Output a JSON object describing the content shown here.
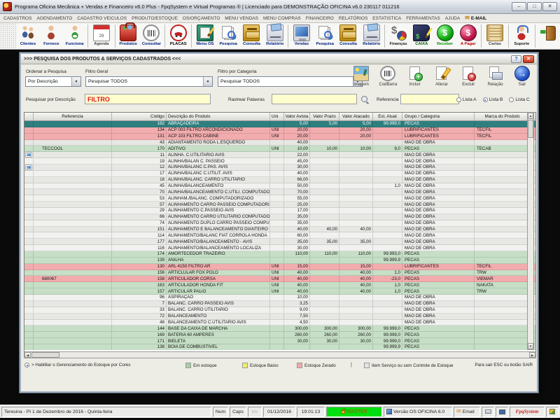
{
  "colors": {
    "selected_row": "#2F7F7F",
    "row_in_stock": "#C6DFC6",
    "row_zero_stock": "#F2ACAE",
    "search_text": "#E01818",
    "master_badge": "#00E010",
    "brand_text": "#CC2020"
  },
  "title_bar": {
    "title": "Programa Oficina Mecânica + Vendas e Financeiro v6.0 Plus - FpqSystem e Virtual Programas ® | Licenciado para  DEMONSTRAÇÃO OFICINA v6.0 230117 011216"
  },
  "menu_bar": {
    "items": [
      {
        "label": "CADASTROS"
      },
      {
        "label": "AGENDAMENTO"
      },
      {
        "label": "CADASTRO VEICULOS"
      },
      {
        "label": "PRODUTO/ESTOQUE"
      },
      {
        "label": "OS/ORÇAMENTO"
      },
      {
        "label": "MENU VENDAS"
      },
      {
        "label": "MENU COMPRAS"
      },
      {
        "label": "FINANCEIRO"
      },
      {
        "label": "RELATÓRIOS"
      },
      {
        "label": "ESTATISTICA"
      },
      {
        "label": "FERRAMENTAS"
      },
      {
        "label": "AJUDA"
      },
      {
        "label": "E-MAIL",
        "icon": "email-icon",
        "bold": true
      }
    ]
  },
  "toolbar": {
    "buttons": [
      {
        "label": "Clientes",
        "icon": "clients-icon",
        "color": "#002080"
      },
      {
        "label": "Fornece",
        "icon": "suppliers-icon",
        "color": "#002080"
      },
      {
        "label": "Funciona",
        "icon": "employees-icon",
        "color": "#002080"
      },
      {
        "label": "Agenda",
        "icon": "calendar-icon",
        "icon_text": "29",
        "color": "#454545",
        "sep_before": true
      },
      {
        "label": "Produtos",
        "icon": "toolbox-icon",
        "color": "#002080",
        "sep_before": true
      },
      {
        "label": "Consultar",
        "icon": "barcode-icon",
        "color": "#002080"
      },
      {
        "label": "PLACAS",
        "icon": "car-plate-icon",
        "color": "#000000",
        "sep_before": true
      },
      {
        "label": "Menu OS",
        "icon": "clipboard-icon",
        "color": "#002080",
        "sep_before": true
      },
      {
        "label": "Pesquisa",
        "icon": "search-docs-icon",
        "color": "#002080"
      },
      {
        "label": "Consulta",
        "icon": "drawer-icon",
        "color": "#002080"
      },
      {
        "label": "Relatório",
        "icon": "printer-icon",
        "color": "#002080"
      },
      {
        "label": "Vendas",
        "icon": "monitor-icon",
        "color": "#002080",
        "sep_before": true
      },
      {
        "label": "Pesquisa",
        "icon": "search-docs-icon",
        "color": "#002080"
      },
      {
        "label": "Consulta",
        "icon": "drawer-icon",
        "color": "#002080"
      },
      {
        "label": "Relatório",
        "icon": "printer-icon",
        "color": "#002080"
      },
      {
        "label": "Finanças",
        "icon": "finance-icon",
        "color": "#202020",
        "sep_before": true
      },
      {
        "label": "CAIXA",
        "icon": "cashbook-icon",
        "color": "#006000"
      },
      {
        "label": "Receber",
        "icon": "receive-icon",
        "color": "#009000"
      },
      {
        "label": "A Pagar",
        "icon": "pay-icon",
        "color": "#C00000"
      },
      {
        "label": "Cartas",
        "icon": "scroll-icon",
        "color": "#454545",
        "sep_before": true
      },
      {
        "label": "Suporte",
        "icon": "support-icon",
        "color": "#202020",
        "sep_before": true
      },
      {
        "label": "",
        "icon": "exit-icon",
        "color": "#202020",
        "sep_before": true
      }
    ]
  },
  "window": {
    "title": ">>>  PESQUISA DOS PRODUTOS & SERVIÇOS CADASTRADOS  <<<",
    "help_button": "?",
    "close_button": "x",
    "filters": {
      "ordenar_label": "Ordenar a Pesquisa",
      "ordenar_value": "Por Descrição",
      "geral_label": "Filtro Geral",
      "geral_value": "Pesquisar TODOS",
      "categoria_label": "Filtro por Categoria",
      "categoria_value": "Pesquisar TODOS"
    },
    "search": {
      "desc_label": "Pesquisar por Descrição",
      "desc_value": "FILTRO",
      "rastrear_label": "Rastrear Palavras",
      "rastrear_value": "",
      "ref_label": "Referencia",
      "ref_value": ""
    },
    "actions": [
      {
        "label": "Imagem",
        "icon": "image-icon"
      },
      {
        "label": "CodBarra",
        "icon": "codbarra-icon"
      },
      {
        "label": "Incluir",
        "icon": "incluir-icon"
      },
      {
        "label": "Alterar",
        "icon": "alterar-icon"
      },
      {
        "label": "Excluir",
        "icon": "excluir-icon"
      },
      {
        "label": "Relação",
        "icon": "relacao-icon"
      },
      {
        "label": "Sair",
        "icon": "sair-icon"
      }
    ],
    "lists": {
      "options": [
        "Lista A",
        "Lista B",
        "Lista C"
      ],
      "selected": "Lista B"
    },
    "table": {
      "columns": [
        "Referencia",
        "Código",
        "Descrição do Produto",
        "Uni",
        "Valor Avista",
        "Valor Prazo",
        "Valor Atacado",
        "Est. Atual",
        "Grupo / Categoria",
        "Marca do Produto"
      ],
      "rows": [
        {
          "ref": "",
          "codigo": "182",
          "desc": "ABRAÇADEIRA",
          "uni": "",
          "avista": "5,00",
          "prazo": "5,00",
          "atacado": "5,00",
          "est": "99.999,0",
          "grupo": "PECAS",
          "marca": "",
          "color": "teal",
          "img": false
        },
        {
          "ref": "",
          "codigo": "134",
          "desc": "ACP 003 FILTRO ARCONDICIONADO",
          "uni": "UNI",
          "avista": "20,00",
          "prazo": "",
          "atacado": "20,00",
          "est": "",
          "grupo": "LUBRIFICANTES",
          "marca": "TECFIL",
          "color": "pink",
          "img": false
        },
        {
          "ref": "",
          "codigo": "131",
          "desc": "ACP 103 FILTRO CABINE",
          "uni": "UNI",
          "avista": "20,00",
          "prazo": "",
          "atacado": "20,00",
          "est": "",
          "grupo": "LUBRIFICANTES",
          "marca": "TECFIL",
          "color": "pink",
          "img": false
        },
        {
          "ref": "",
          "codigo": "43",
          "desc": "ADIANTAMENTO RODA L.ESQUERDO",
          "uni": "",
          "avista": "40,00",
          "prazo": "",
          "atacado": "",
          "est": "",
          "grupo": "MAO DE OBRA",
          "marca": "",
          "color": "",
          "img": false
        },
        {
          "ref": "TECCOOL",
          "codigo": "170",
          "desc": "ADITIVO",
          "uni": "UNI",
          "avista": "10,00",
          "prazo": "10,00",
          "atacado": "10,00",
          "est": "9,0",
          "grupo": "PECAS",
          "marca": "TECAB",
          "color": "green",
          "img": false
        },
        {
          "ref": "",
          "codigo": "11",
          "desc": "ALINHA. C.UTILITARIO AVIS",
          "uni": "",
          "avista": "22,00",
          "prazo": "",
          "atacado": "",
          "est": "",
          "grupo": "MAO DE OBRA",
          "marca": "",
          "color": "",
          "img": true
        },
        {
          "ref": "",
          "codigo": "19",
          "desc": "ALINHA/BALAN C. PASSEIO",
          "uni": "",
          "avista": "45,00",
          "prazo": "",
          "atacado": "",
          "est": "",
          "grupo": "MAO DE OBRA",
          "marca": "",
          "color": "",
          "img": false
        },
        {
          "ref": "",
          "codigo": "12",
          "desc": "ALINHA/BALANC C.PAS. AVIS",
          "uni": "",
          "avista": "30,00",
          "prazo": "",
          "atacado": "",
          "est": "",
          "grupo": "MAO DE OBRA",
          "marca": "",
          "color": "",
          "img": true
        },
        {
          "ref": "",
          "codigo": "17",
          "desc": "ALINHA/BALANC C.UTILIT. AVIS",
          "uni": "",
          "avista": "40,00",
          "prazo": "",
          "atacado": "",
          "est": "",
          "grupo": "MAO DE OBRA",
          "marca": "",
          "color": "",
          "img": false
        },
        {
          "ref": "",
          "codigo": "18",
          "desc": "ALINHA/BALANC. CARRO UTILITARIO",
          "uni": "",
          "avista": "66,00",
          "prazo": "",
          "atacado": "",
          "est": "",
          "grupo": "MAO DE OBRA",
          "marca": "",
          "color": "",
          "img": false
        },
        {
          "ref": "",
          "codigo": "45",
          "desc": "ALINHA/BALANCEAMENTO",
          "uni": "",
          "avista": "50,00",
          "prazo": "",
          "atacado": "",
          "est": "1,0",
          "grupo": "MAO DE OBRA",
          "marca": "",
          "color": "",
          "img": false
        },
        {
          "ref": "",
          "codigo": "70",
          "desc": "ALINHA/BALANCEAMENTO C.UTILI. COMPUTADORIZADO",
          "uni": "",
          "avista": "70,00",
          "prazo": "",
          "atacado": "",
          "est": "",
          "grupo": "MAO DE OBRA",
          "marca": "",
          "color": "",
          "img": false
        },
        {
          "ref": "",
          "codigo": "53",
          "desc": "ALINHAM./BALANC.  COMPUTADORIZADO",
          "uni": "",
          "avista": "55,00",
          "prazo": "",
          "atacado": "",
          "est": "",
          "grupo": "MAO DE OBRA",
          "marca": "",
          "color": "",
          "img": false
        },
        {
          "ref": "",
          "codigo": "57",
          "desc": "ALINHAMENTO  CARRO PASSEIO  COMPUTADORIZADO",
          "uni": "",
          "avista": "25,00",
          "prazo": "",
          "atacado": "",
          "est": "",
          "grupo": "MAO DE OBRA",
          "marca": "",
          "color": "",
          "img": false
        },
        {
          "ref": "",
          "codigo": "29",
          "desc": "ALINHAMENTO C.PASSEIO AVIS",
          "uni": "",
          "avista": "17,00",
          "prazo": "",
          "atacado": "",
          "est": "",
          "grupo": "MAO DE OBRA",
          "marca": "",
          "color": "",
          "img": false
        },
        {
          "ref": "",
          "codigo": "66",
          "desc": "ALINHAMENTO CARRO UTILITARIO COMPUTADORIZADO",
          "uni": "",
          "avista": "35,00",
          "prazo": "",
          "atacado": "",
          "est": "",
          "grupo": "MAO DE OBRA",
          "marca": "",
          "color": "",
          "img": false
        },
        {
          "ref": "",
          "codigo": "74",
          "desc": "ALINHAMENTO DUPLO CARRO PASSEIO COMPUTADORIZADO",
          "uni": "",
          "avista": "35,00",
          "prazo": "",
          "atacado": "",
          "est": "",
          "grupo": "MAO DE OBRA",
          "marca": "",
          "color": "",
          "img": false
        },
        {
          "ref": "",
          "codigo": "151",
          "desc": "ALINHAMENTO E BALANCEAMENTO DIANTEIRO",
          "uni": "",
          "avista": "40,00",
          "prazo": "40,00",
          "atacado": "40,00",
          "est": "",
          "grupo": "MAO DE OBRA",
          "marca": "",
          "color": "",
          "img": false
        },
        {
          "ref": "",
          "codigo": "114",
          "desc": "ALINHAMENTO/BALANC   FIAT CORROLA HONDA",
          "uni": "",
          "avista": "60,00",
          "prazo": "",
          "atacado": "",
          "est": "",
          "grupo": "MAO DE OBRA",
          "marca": "",
          "color": "",
          "img": false
        },
        {
          "ref": "",
          "codigo": "177",
          "desc": "ALINHAMENTO/BALANCEAMENTO - AVIS",
          "uni": "",
          "avista": "35,00",
          "prazo": "35,00",
          "atacado": "35,00",
          "est": "",
          "grupo": "MAO DE OBRA",
          "marca": "",
          "color": "",
          "img": false
        },
        {
          "ref": "",
          "codigo": "116",
          "desc": "ALINHAMENTO/BALANCEAMENTO LOCALIZA",
          "uni": "",
          "avista": "30,00",
          "prazo": "",
          "atacado": "",
          "est": "",
          "grupo": "MAO DE OBRA",
          "marca": "",
          "color": "",
          "img": false
        },
        {
          "ref": "",
          "codigo": "174",
          "desc": "AMORTECEDOR TRAZEIRO",
          "uni": "",
          "avista": "110,00",
          "prazo": "110,00",
          "atacado": "110,00",
          "est": "99.993,0",
          "grupo": "PECAS",
          "marca": "",
          "color": "green",
          "img": false
        },
        {
          "ref": "",
          "codigo": "139",
          "desc": "ANILHA",
          "uni": "",
          "avista": "",
          "prazo": "",
          "atacado": "",
          "est": "99.999,9",
          "grupo": "PECAS",
          "marca": "",
          "color": "green",
          "img": false
        },
        {
          "ref": "",
          "codigo": "130",
          "desc": "ARL 4150  FILTRO AR",
          "uni": "UNI",
          "avista": "15,00",
          "prazo": "",
          "atacado": "15,00",
          "est": "",
          "grupo": "LUBRIFICANTES",
          "marca": "TECFIL",
          "color": "pink",
          "img": false
        },
        {
          "ref": "",
          "codigo": "156",
          "desc": "ARTICLULAR FOX POLO",
          "uni": "UNI",
          "avista": "40,00",
          "prazo": "",
          "atacado": "40,00",
          "est": "1,0",
          "grupo": "PECAS",
          "marca": "TRW",
          "color": "green",
          "img": false
        },
        {
          "ref": "680067",
          "codigo": "158",
          "desc": "ARTICULADOR CORSA",
          "uni": "UNI",
          "avista": "40,00",
          "prazo": "",
          "atacado": "40,00",
          "est": "-23,0",
          "grupo": "PECAS",
          "marca": "VIEMAR",
          "color": "pink",
          "img": false
        },
        {
          "ref": "",
          "codigo": "163",
          "desc": "ARTICULADOR HONDA FIT",
          "uni": "UNI",
          "avista": "40,00",
          "prazo": "",
          "atacado": "40,00",
          "est": "1,0",
          "grupo": "PECAS",
          "marca": "NAKATA",
          "color": "green",
          "img": false
        },
        {
          "ref": "",
          "codigo": "157",
          "desc": "ARTICULAR PALIO",
          "uni": "UNI",
          "avista": "40,00",
          "prazo": "",
          "atacado": "40,00",
          "est": "1,0",
          "grupo": "PECAS",
          "marca": "TRW",
          "color": "green",
          "img": false
        },
        {
          "ref": "",
          "codigo": "96",
          "desc": "ASPIRAÇÃO",
          "uni": "",
          "avista": "10,00",
          "prazo": "",
          "atacado": "",
          "est": "",
          "grupo": "MAO DE OBRA",
          "marca": "",
          "color": "",
          "img": false
        },
        {
          "ref": "",
          "codigo": "7",
          "desc": "BALANC. CARRO PASSEIO AVIS",
          "uni": "",
          "avista": "3,25",
          "prazo": "",
          "atacado": "",
          "est": "",
          "grupo": "MAO DE OBRA",
          "marca": "",
          "color": "",
          "img": false
        },
        {
          "ref": "",
          "codigo": "33",
          "desc": "BALANC. CARRO UTILITARIO",
          "uni": "",
          "avista": "9,00",
          "prazo": "",
          "atacado": "",
          "est": "",
          "grupo": "MAO DE OBRA",
          "marca": "",
          "color": "",
          "img": false
        },
        {
          "ref": "",
          "codigo": "72",
          "desc": "BALANCEAMENTO",
          "uni": "",
          "avista": "7,50",
          "prazo": "",
          "atacado": "",
          "est": "",
          "grupo": "MAO DE OBRA",
          "marca": "",
          "color": "",
          "img": false
        },
        {
          "ref": "",
          "codigo": "48",
          "desc": "BALANCEAMENTO  C.UTILITARIO AVIS",
          "uni": "",
          "avista": "4,50",
          "prazo": "",
          "atacado": "",
          "est": "",
          "grupo": "MAO DE OBRA",
          "marca": "",
          "color": "",
          "img": false
        },
        {
          "ref": "",
          "codigo": "144",
          "desc": "BASE DA CAIXA DE MARCHA",
          "uni": "",
          "avista": "300,00",
          "prazo": "300,00",
          "atacado": "300,00",
          "est": "99.999,0",
          "grupo": "PECAS",
          "marca": "",
          "color": "green",
          "img": false
        },
        {
          "ref": "",
          "codigo": "169",
          "desc": "BATERIA 60 AMPERES",
          "uni": "",
          "avista": "260,00",
          "prazo": "260,00",
          "atacado": "260,00",
          "est": "99.999,0",
          "grupo": "PECAS",
          "marca": "",
          "color": "green",
          "img": false
        },
        {
          "ref": "",
          "codigo": "171",
          "desc": "BIELETA",
          "uni": "",
          "avista": "30,00",
          "prazo": "30,00",
          "atacado": "30,00",
          "est": "99.999,0",
          "grupo": "PECAS",
          "marca": "",
          "color": "green",
          "img": false
        },
        {
          "ref": "",
          "codigo": "138",
          "desc": "BOIA DE COMBUSTIVEL",
          "uni": "",
          "avista": "",
          "prazo": "",
          "atacado": "",
          "est": "99.999,9",
          "grupo": "PECAS",
          "marca": "",
          "color": "green",
          "img": false
        }
      ]
    },
    "legend": {
      "toggle_label": "> Habilitar o Gerenciamento do Estoque por Cores",
      "items": [
        {
          "label": "Em estoque",
          "color": "#A8CEA8"
        },
        {
          "label": "Estoque Baixo",
          "color": "#EEEE66"
        },
        {
          "label": "Estoque Zerado",
          "color": "#F0A8A8"
        },
        {
          "label": "Item Serviço ou sem Controle de Estoque",
          "color": "#E4E4E4"
        }
      ],
      "divider": "|",
      "exit_hint": "Para sair ESC ou botão SAIR"
    }
  },
  "status_bar": {
    "location": "Teresina - PI  1 de Dezembro de 2016 - Quinta-feira",
    "num": "Num",
    "caps": "Caps",
    "ins": "Ins",
    "date": "01/12/2016",
    "time": "19:01:13",
    "user": "MASTER",
    "version": "Versão OS OFICINA 6.0",
    "email": "Email",
    "brand": "FpqSystem"
  }
}
